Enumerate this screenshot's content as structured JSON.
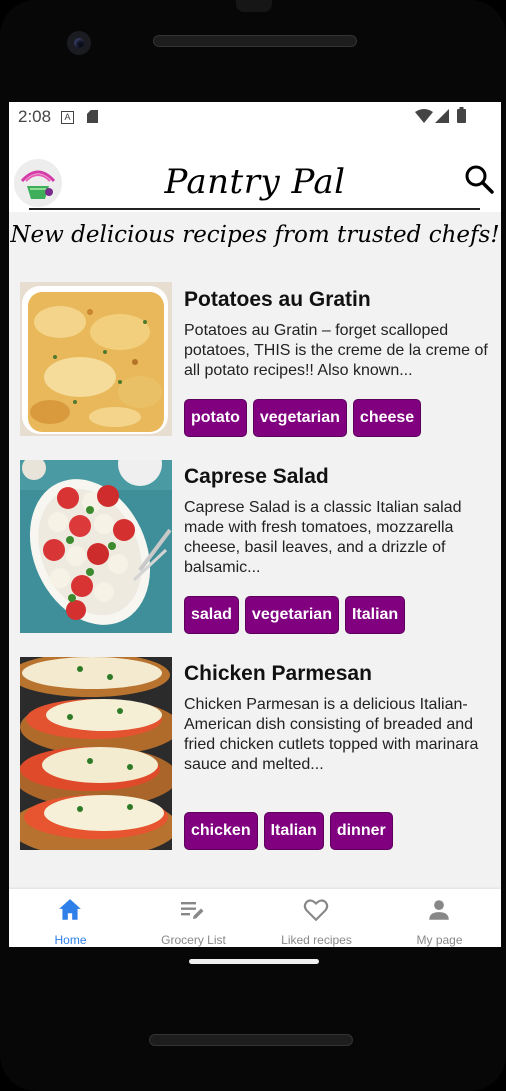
{
  "status_bar": {
    "time": "2:08"
  },
  "header": {
    "title": "Pantry Pal"
  },
  "subtitle": "New delicious recipes from trusted chefs!",
  "recipes": [
    {
      "title": "Potatoes au Gratin",
      "description": "Potatoes au Gratin – forget scalloped potatoes, THIS is the creme de la creme of all potato recipes!! Also known...",
      "tags": [
        "potato",
        "vegetarian",
        "cheese"
      ]
    },
    {
      "title": "Caprese Salad",
      "description": "Caprese Salad is a classic Italian salad made with fresh tomatoes, mozzarella cheese, basil leaves, and a drizzle of balsamic...",
      "tags": [
        "salad",
        "vegetarian",
        "Italian"
      ]
    },
    {
      "title": "Chicken Parmesan",
      "description": "Chicken Parmesan is a delicious Italian-American dish consisting of breaded and fried chicken cutlets topped with marinara sauce and melted...",
      "tags": [
        "chicken",
        "Italian",
        "dinner"
      ]
    }
  ],
  "bottom_nav": [
    {
      "label": "Home",
      "icon": "home-icon",
      "active": true
    },
    {
      "label": "Grocery List",
      "icon": "grocery-list-icon",
      "active": false
    },
    {
      "label": "Liked recipes",
      "icon": "heart-icon",
      "active": false
    },
    {
      "label": "My page",
      "icon": "person-icon",
      "active": false
    }
  ],
  "colors": {
    "tag": "#800080",
    "nav_active": "#2f7fe8",
    "nav_inactive": "#888888"
  }
}
